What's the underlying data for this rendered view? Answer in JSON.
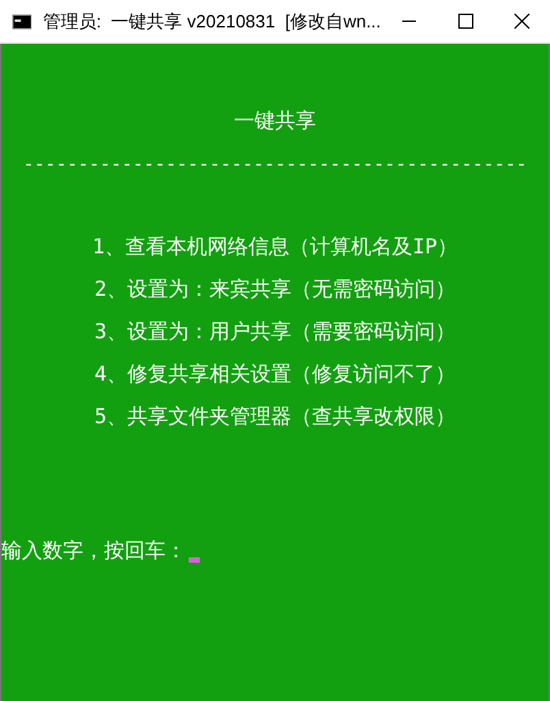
{
  "window": {
    "title": "管理员:  一键共享 v20210831  [修改自wn..."
  },
  "console": {
    "heading": "一键共享",
    "separator": "----------------------------------------------",
    "menu": [
      "1、查看本机网络信息（计算机名及IP）",
      "2、设置为：来宾共享（无需密码访问）",
      "3、设置为：用户共享（需要密码访问）",
      "4、修复共享相关设置（修复访问不了）",
      "5、共享文件夹管理器（查共享改权限）"
    ],
    "prompt": "输入数字，按回车："
  }
}
